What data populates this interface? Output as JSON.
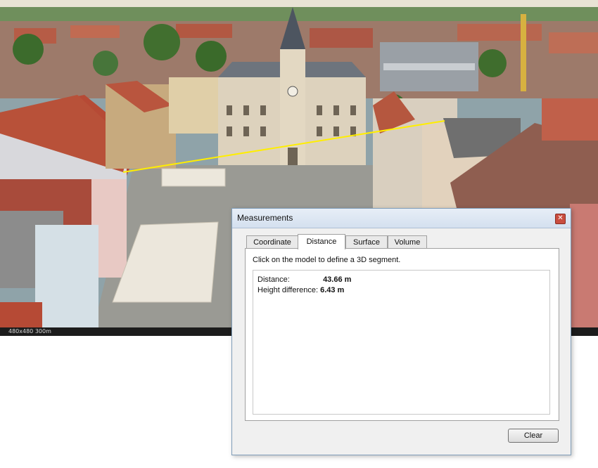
{
  "viewport": {
    "status_left": "480x480  300m",
    "colors": {
      "sky": "#e8e3d4",
      "roof": "#b64a35",
      "wall": "#d8cfc0",
      "tree": "#3c6b2c",
      "square": "#9a9a94",
      "segment": "#ffee00"
    }
  },
  "dialog": {
    "title": "Measurements",
    "close_icon": "close-icon",
    "tabs": [
      {
        "label": "Coordinate",
        "active": false
      },
      {
        "label": "Distance",
        "active": true
      },
      {
        "label": "Surface",
        "active": false
      },
      {
        "label": "Volume",
        "active": false
      }
    ],
    "instruction": "Click on the model to define a 3D segment.",
    "results": {
      "distance_label": "Distance:",
      "distance_value": "43.66 m",
      "height_label": "Height difference:",
      "height_value": "6.43 m"
    },
    "clear_label": "Clear"
  }
}
